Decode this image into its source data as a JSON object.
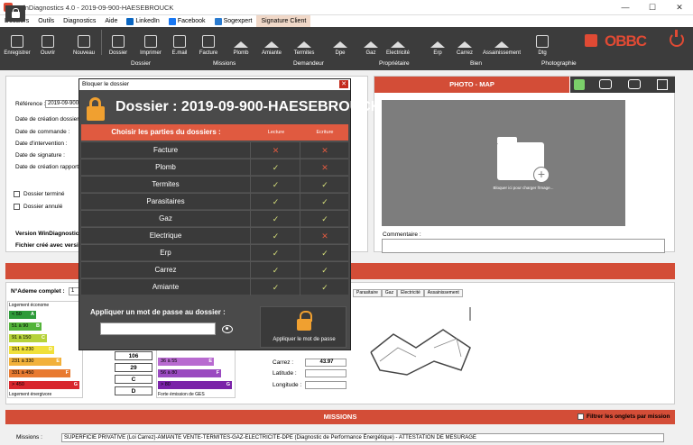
{
  "window": {
    "title": "WinDiagnostics 4.0 - 2019-09-900-HAESEBROUCK",
    "minimize": "—",
    "maximize": "☐",
    "close": "✕"
  },
  "menu": [
    {
      "label": "Dossiers"
    },
    {
      "label": "Outils"
    },
    {
      "label": "Diagnostics"
    },
    {
      "label": "Aide"
    },
    {
      "label": "LinkedIn",
      "icon": "linkedin-icon"
    },
    {
      "label": "Facebook",
      "icon": "facebook-icon"
    },
    {
      "label": "Sogexpert",
      "icon": "sogexpert-icon"
    },
    {
      "label": "Signature Client"
    }
  ],
  "toolbar": [
    {
      "label": "Enregistrer"
    },
    {
      "label": "Ouvrir"
    },
    {
      "label": "Nouveau"
    },
    {
      "label": "Dossier"
    },
    {
      "label": "Imprimer"
    },
    {
      "label": "E.mail"
    },
    {
      "label": "Facture"
    },
    {
      "label": "Plomb"
    },
    {
      "label": "Amiante"
    },
    {
      "label": "Termites"
    },
    {
      "label": "Dpe"
    },
    {
      "label": "Gaz"
    },
    {
      "label": "Electricité"
    },
    {
      "label": "Erp"
    },
    {
      "label": "Carrez"
    },
    {
      "label": "Assainissement"
    },
    {
      "label": "Dtg"
    }
  ],
  "brand": {
    "logo": "OBBC"
  },
  "tabs": [
    "Dossier",
    "Missions",
    "Demandeur",
    "Propriétaire",
    "Bien",
    "Photographie"
  ],
  "form": {
    "reference_label": "Référence :",
    "reference_value": "2019-09-900",
    "fields": [
      "Date de création dossier :",
      "Date de commande :",
      "Date d'intervention :",
      "Date de signature :",
      "Date de création rapport :"
    ],
    "checkbox_termine": "Dossier terminé",
    "checkbox_annule": "Dossier annulé",
    "version_label": "Version WinDiagnostic",
    "created_with": "Fichier créé avec versi"
  },
  "photo_panel": {
    "title": "PHOTO - MAP",
    "hint": "Bloquer ici pour charger l'image...",
    "comment_label": "Commentaire :"
  },
  "dpe": {
    "ademe_label": "N°Ademe complet :",
    "ademe_value": "1",
    "logement_econome": "Logement économe",
    "logement_energivore": "Logement énergivore",
    "classes": [
      {
        "range": "< 50",
        "letter": "A",
        "color": "#2e9b3a"
      },
      {
        "range": "51 à 90",
        "letter": "B",
        "color": "#53b33a"
      },
      {
        "range": "91 à 150",
        "letter": "C",
        "color": "#b6d23a"
      },
      {
        "range": "151 à 230",
        "letter": "D",
        "color": "#f0e03a"
      },
      {
        "range": "231 à 330",
        "letter": "E",
        "color": "#f2b13a"
      },
      {
        "range": "331 à 450",
        "letter": "F",
        "color": "#e87a30"
      },
      {
        "range": "> 450",
        "letter": "G",
        "color": "#d8262d"
      }
    ],
    "values": [
      "106",
      "29",
      "C",
      "D"
    ],
    "ges_classes": [
      {
        "range": "36 à 55",
        "letter": "E",
        "color": "#b86ad0"
      },
      {
        "range": "56 à 80",
        "letter": "F",
        "color": "#9a4ac0"
      },
      {
        "range": "> 80",
        "letter": "G",
        "color": "#7a22a8"
      }
    ],
    "ges_label": "Forte émission de GES"
  },
  "plan": {
    "tabs": [
      "Parasitaire",
      "Gaz",
      "Electricité",
      "Assainissement"
    ],
    "carrez_label": "Carrez :",
    "carrez_value": "43.97",
    "latitude_label": "Latitude :",
    "longitude_label": "Longitude :"
  },
  "missions": {
    "header": "MISSIONS",
    "filter_label": "Filtrer les onglets par mission",
    "missions_label": "Missions :",
    "missions_value": "SUPERFICIE PRIVATIVE (Loi Carrez)-AMIANTE VENTE-TERMITES-GAZ-ELECTRICITE-DPE (Diagnostic de Performance Énergétique) - ATTESTATION DE MESURAGE"
  },
  "modal": {
    "window_title": "Bloquer le dossier",
    "title": "Dossier : 2019-09-900-HAESEBROUCK",
    "col_parts": "Choisir les parties du dossiers :",
    "col_read": "Lecture",
    "col_write": "Ecriture",
    "rows": [
      {
        "name": "Facture",
        "read": "✕",
        "write": "✕",
        "read_ok": false,
        "write_ok": false
      },
      {
        "name": "Plomb",
        "read": "✓",
        "write": "✕",
        "read_ok": true,
        "write_ok": false
      },
      {
        "name": "Termites",
        "read": "✓",
        "write": "✓",
        "read_ok": true,
        "write_ok": true
      },
      {
        "name": "Parasitaires",
        "read": "✓",
        "write": "✓",
        "read_ok": true,
        "write_ok": true
      },
      {
        "name": "Gaz",
        "read": "✓",
        "write": "✓",
        "read_ok": true,
        "write_ok": true
      },
      {
        "name": "Electrique",
        "read": "✓",
        "write": "✕",
        "read_ok": true,
        "write_ok": false
      },
      {
        "name": "Erp",
        "read": "✓",
        "write": "✓",
        "read_ok": true,
        "write_ok": true
      },
      {
        "name": "Carrez",
        "read": "✓",
        "write": "✓",
        "read_ok": true,
        "write_ok": true
      },
      {
        "name": "Amiante",
        "read": "✓",
        "write": "✓",
        "read_ok": true,
        "write_ok": true
      }
    ],
    "password_label": "Appliquer un mot de passe au dossier :",
    "apply_label": "Appliquer le mot de passe"
  }
}
